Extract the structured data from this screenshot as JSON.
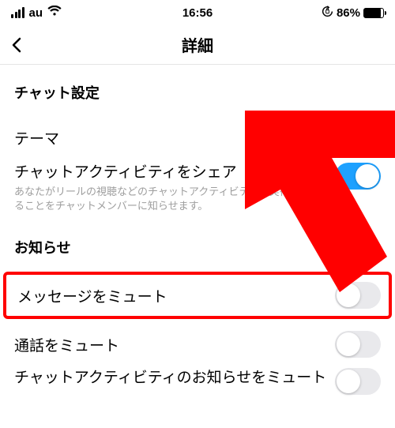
{
  "status": {
    "carrier": "au",
    "time": "16:56",
    "battery_pct": "86%"
  },
  "nav": {
    "title": "詳細"
  },
  "sections": {
    "chat_settings_header": "チャット設定",
    "theme_label": "テーマ",
    "share_activity_label": "チャットアクティビティをシェア",
    "share_activity_sub": "あなたがリールの視聴などのチャットアクティビティを実行中であることをチャットメンバーに知らせます。",
    "notifications_header": "お知らせ",
    "mute_messages_label": "メッセージをミュート",
    "mute_calls_label": "通話をミュート",
    "mute_activity_label": "チャットアクティビティのお知らせをミュート"
  },
  "toggles": {
    "share_activity": true,
    "mute_messages": false,
    "mute_calls": false,
    "mute_activity": false
  }
}
